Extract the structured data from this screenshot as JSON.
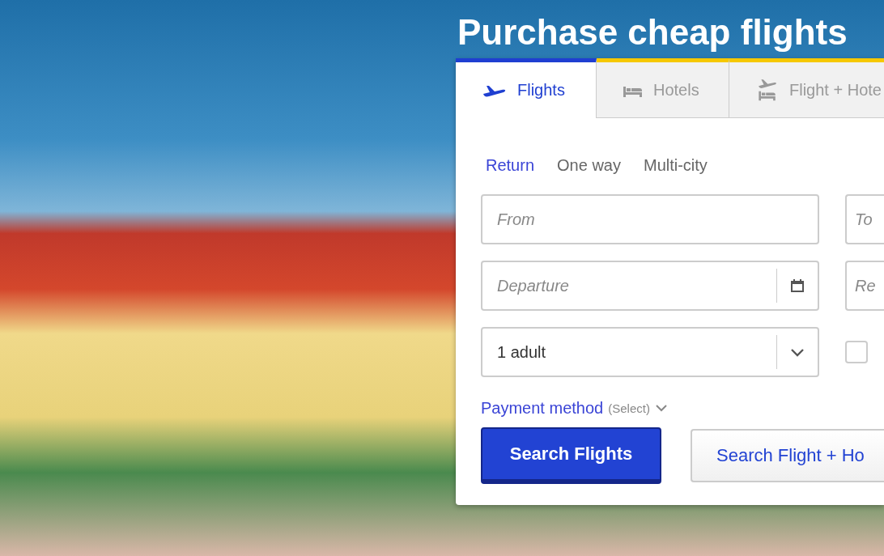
{
  "title": "Purchase cheap flights",
  "tabs": [
    {
      "label": "Flights",
      "kind": "plane",
      "selected": true
    },
    {
      "label": "Hotels",
      "kind": "bed",
      "selected": false
    },
    {
      "label": "Flight + Hote",
      "kind": "plane-bed",
      "selected": false
    }
  ],
  "trip_types": [
    {
      "label": "Return",
      "selected": true
    },
    {
      "label": "One way",
      "selected": false
    },
    {
      "label": "Multi-city",
      "selected": false
    }
  ],
  "fields": {
    "from": {
      "placeholder": "From"
    },
    "to": {
      "placeholder": "To"
    },
    "departure": {
      "placeholder": "Departure"
    },
    "return": {
      "placeholder": "Re"
    }
  },
  "passengers": {
    "value": "1 adult"
  },
  "option_checkbox": {
    "checked": false
  },
  "payment": {
    "label": "Payment method",
    "hint": "(Select)"
  },
  "buttons": [
    {
      "label": "Search Flights",
      "kind": "primary"
    },
    {
      "label": "Search Flight + Ho",
      "kind": "secondary"
    }
  ]
}
